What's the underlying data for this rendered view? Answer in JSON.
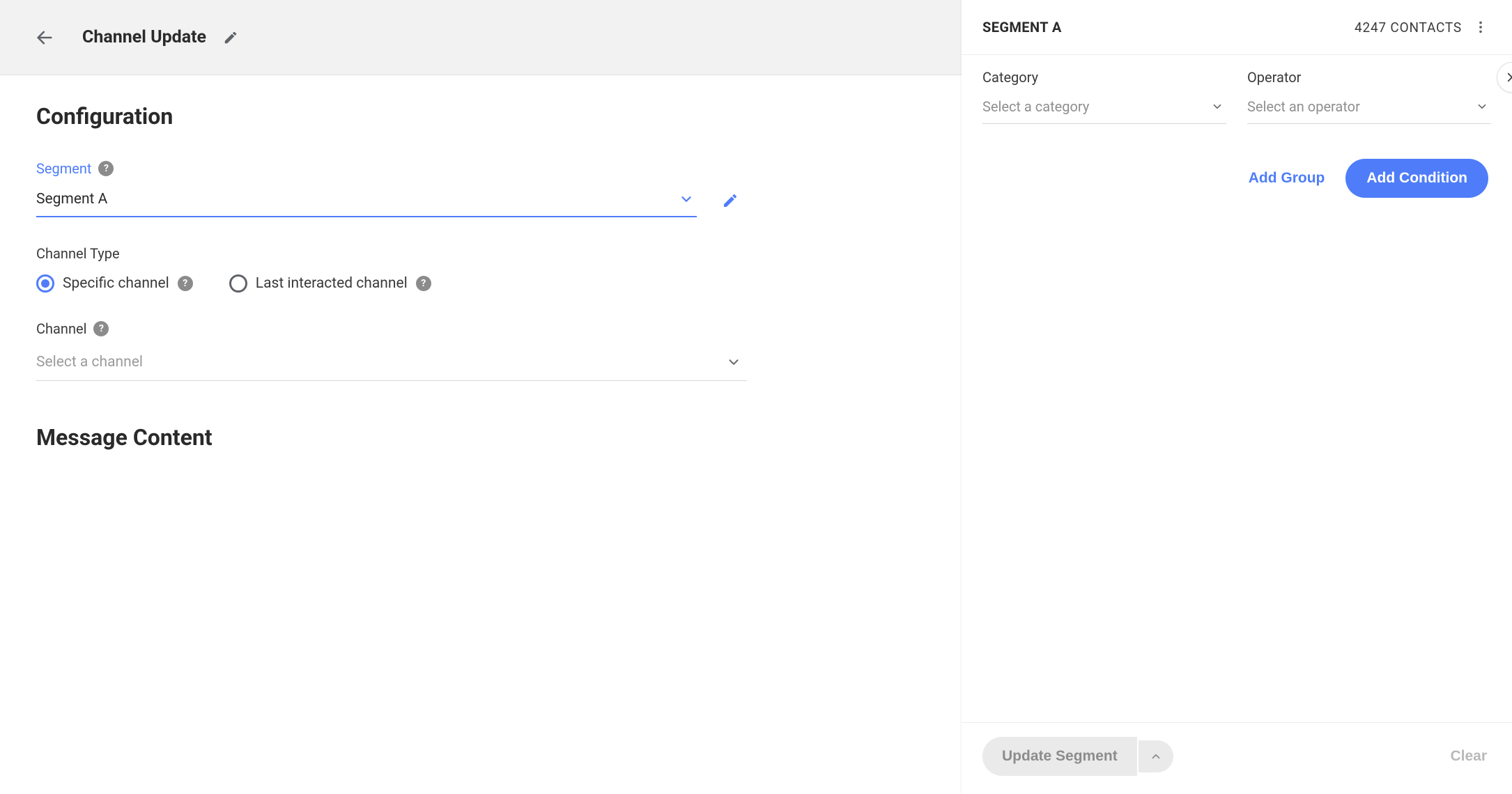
{
  "header": {
    "title": "Channel Update"
  },
  "config": {
    "heading": "Configuration",
    "segment": {
      "label": "Segment",
      "selected": "Segment A"
    },
    "channel_type": {
      "label": "Channel Type",
      "options": [
        {
          "label": "Specific channel",
          "selected": true
        },
        {
          "label": "Last interacted channel",
          "selected": false
        }
      ]
    },
    "channel": {
      "label": "Channel",
      "placeholder": "Select a channel"
    }
  },
  "message": {
    "heading": "Message Content"
  },
  "panel": {
    "title": "SEGMENT A",
    "contacts_label": "4247 CONTACTS",
    "category": {
      "label": "Category",
      "placeholder": "Select a category"
    },
    "operator": {
      "label": "Operator",
      "placeholder": "Select an operator"
    },
    "add_group_label": "Add Group",
    "add_condition_label": "Add Condition",
    "update_label": "Update Segment",
    "clear_label": "Clear"
  }
}
